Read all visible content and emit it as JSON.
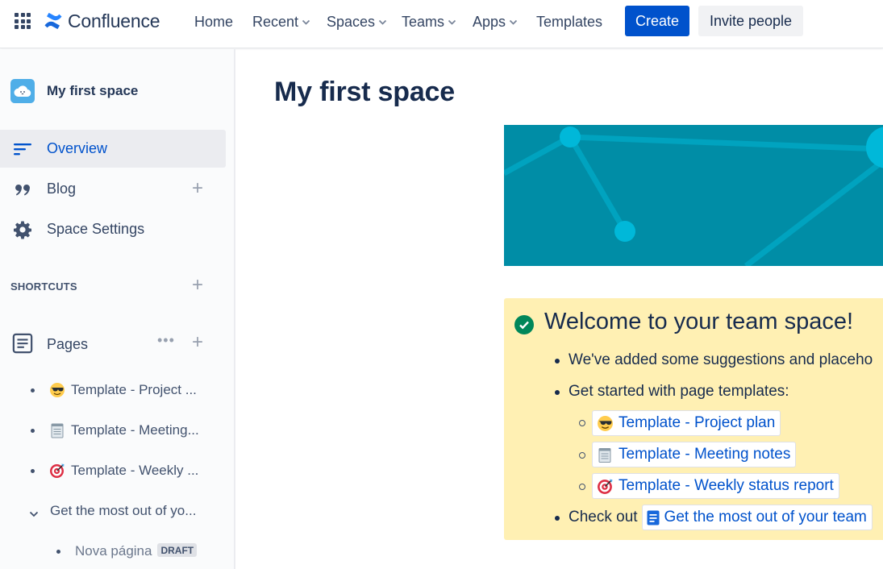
{
  "nav": {
    "brand": "Confluence",
    "items": [
      "Home",
      "Recent",
      "Spaces",
      "Teams",
      "Apps",
      "Templates"
    ],
    "create_label": "Create",
    "invite_label": "Invite people"
  },
  "sidebar": {
    "space_name": "My first space",
    "items": [
      {
        "label": "Overview"
      },
      {
        "label": "Blog"
      },
      {
        "label": "Space Settings"
      }
    ],
    "shortcuts_label": "SHORTCUTS",
    "pages_label": "Pages",
    "tree": [
      {
        "label": "Template - Project ...",
        "emoji": "sunglasses"
      },
      {
        "label": "Template - Meeting...",
        "emoji": "notepad"
      },
      {
        "label": "Template - Weekly ...",
        "emoji": "dart"
      },
      {
        "label": "Get the most out of yo..."
      },
      {
        "label": "Nova página",
        "badge": "DRAFT"
      }
    ]
  },
  "main": {
    "title": "My first space",
    "panel": {
      "heading": "Welcome to your team space!",
      "bullet1": "We've added some suggestions and placeho",
      "bullet2": "Get started with page templates:",
      "templates": [
        {
          "label": "Template - Project plan",
          "emoji": "sunglasses"
        },
        {
          "label": "Template - Meeting notes",
          "emoji": "notepad"
        },
        {
          "label": "Template - Weekly status report",
          "emoji": "dart"
        }
      ],
      "bullet3_prefix": "Check out",
      "bullet3_link": "Get the most out of your team"
    }
  },
  "colors": {
    "primary": "#0052cc",
    "banner": "#008da6",
    "panel": "#fff0b3",
    "success": "#00875a"
  }
}
